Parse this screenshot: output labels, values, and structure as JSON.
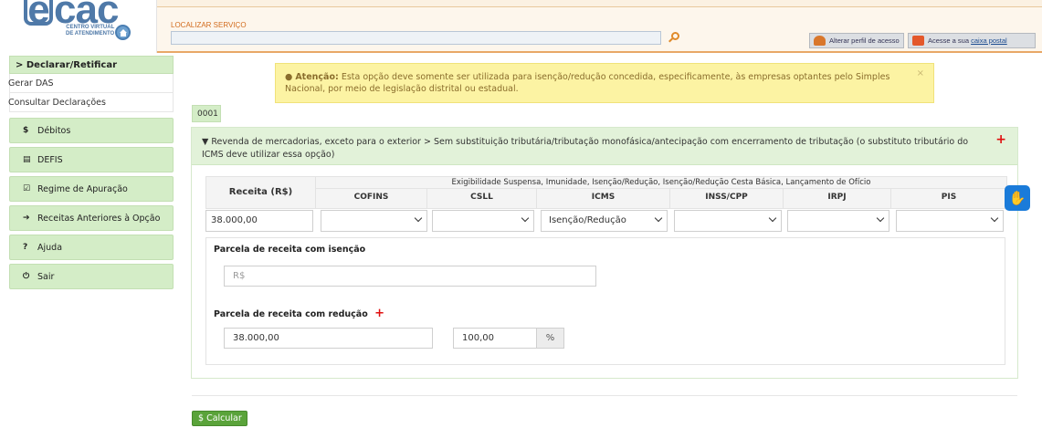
{
  "header": {
    "logo_text": "cac",
    "logo_e": "e",
    "logo_sub_line1": "CENTRO VIRTUAL",
    "logo_sub_line2": "DE ATENDIMENTO",
    "service_label": "LOCALIZAR SERVIÇO",
    "alterar_perfil": "Alterar perfil de acesso",
    "caixa_prefix": "Acesse a sua ",
    "caixa_link": "caixa postal"
  },
  "sidebar": {
    "header": "> Declarar/Retificar",
    "sub_items": [
      "Gerar DAS",
      "Consultar Declarações"
    ],
    "items": [
      {
        "icon": "$",
        "label": "Débitos"
      },
      {
        "icon": "▤",
        "label": "DEFIS"
      },
      {
        "icon": "☑",
        "label": "Regime de Apuração"
      },
      {
        "icon": "➔",
        "label": "Receitas Anteriores à Opção"
      },
      {
        "icon": "?",
        "label": "Ajuda"
      },
      {
        "icon": "⏻",
        "label": "Sair"
      }
    ]
  },
  "alert": {
    "prefix": "Atenção:",
    "text": " Esta opção deve somente ser utilizada para isenção/redução concedida, especificamente, às empresas optantes pelo Simples Nacional, por meio de legislação distrital ou estadual.",
    "close": "×"
  },
  "main": {
    "tag": "0001",
    "panel_title": "▼ Revenda de mercadorias, exceto para o exterior > Sem substituição tributária/tributação monofásica/antecipação com encerramento de tributação (o substituto tributário do ICMS deve utilizar essa opção)",
    "plus": "+",
    "table": {
      "receita_header": "Receita (R$)",
      "group_header": "Exigibilidade Suspensa, Imunidade, Isenção/Redução, Isenção/Redução Cesta Básica, Lançamento de Ofício",
      "columns": [
        "COFINS",
        "CSLL",
        "ICMS",
        "INSS/CPP",
        "IRPJ",
        "PIS"
      ],
      "receita_value": "38.000,00",
      "selected": [
        "",
        "",
        "Isenção/Redução",
        "",
        "",
        ""
      ]
    },
    "isencao_label": "Parcela de receita com isenção",
    "isencao_placeholder": "R$",
    "reducao_label": "Parcela de receita com redução",
    "reducao_plus": "+",
    "reducao_value": "38.000,00",
    "percent_value": "100,00",
    "percent_symbol": "%",
    "calc_button": "$ Calcular"
  },
  "colors": {
    "green_light": "#d4edc7",
    "alert_bg": "#fcf3a3",
    "calc_green": "#5aa33a",
    "accent_orange": "#d26c1e",
    "libras_blue": "#1a7bd9"
  }
}
